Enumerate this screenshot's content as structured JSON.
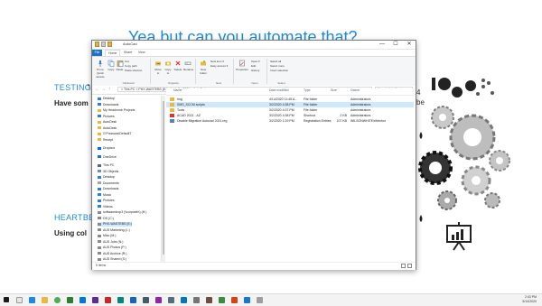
{
  "slide": {
    "title": "Yea but can you automate that?",
    "sec1_title": "TESTING",
    "sec1_body": "Have som",
    "sec2_title": "HEARTBE",
    "sec2_body": "Using col",
    "right_num1": "4",
    "right_text1": "be"
  },
  "window": {
    "title": "AutoCad",
    "controls": {
      "minimize": "—",
      "maximize": "☐",
      "close": "✕"
    },
    "tabs": [
      "File",
      "Home",
      "Share",
      "View"
    ],
    "ribbon": {
      "pin_label": "Pin to Quick access",
      "copy_label": "Copy",
      "paste_label": "Paste",
      "cut_label": "Cut",
      "copy_path_label": "Copy path",
      "paste_shortcut_label": "Paste shortcut",
      "clipboard_group": "Clipboard",
      "move_to_label": "Move to",
      "copy_to_label": "Copy to",
      "delete_label": "Delete",
      "rename_label": "Rename",
      "organize_group": "Organize",
      "new_folder_label": "New folder",
      "new_item_label": "New item ▾",
      "easy_access_label": "Easy access ▾",
      "new_group": "New",
      "properties_label": "Properties",
      "open_label": "Open ▾",
      "edit_label": "Edit",
      "history_label": "History",
      "open_group": "Open",
      "select_all_label": "Select all",
      "select_none_label": "Select none",
      "invert_label": "Invert selection",
      "select_group": "Select"
    },
    "address": "> This PC > PHX-WASTEBS (E:) > Install > 2021 > AutoCad",
    "search_placeholder": "Search AutoCad",
    "nav_items": [
      "Desktop",
      "Downloads",
      "My Headnone Projects",
      "Pictures",
      "AutoDesk",
      "AutoDesk",
      "GY*assocs\\DefaultT",
      "Recept",
      "Dropbox",
      "OneDrive",
      "This PC",
      "3D Objects",
      "Desktop",
      "Documents",
      "Downloads",
      "Music",
      "Pictures",
      "Videos",
      "softwaredrop3 (\\\\corpweb\\) (H:)",
      "OS (C:)",
      "PHX-WASTEBS (E:)",
      "AUS Marketing (L:)",
      "Misc (M:)",
      "AUS Jobs (N:)",
      "AUS Photos (P:)",
      "AUS Archive (R:)",
      "AUS Shared (S:)"
    ],
    "columns": {
      "name": "Name",
      "date": "Date modified",
      "type": "Type",
      "size": "Size",
      "owner": "Owner"
    },
    "files": [
      {
        "name": "Img",
        "date": "4/14/2020 11:45 A...",
        "type": "File folder",
        "size": "",
        "owner": "Administrators"
      },
      {
        "name": "SMS_SCCM scripts",
        "date": "3/2/2020 4:38 PM",
        "type": "File folder",
        "size": "",
        "owner": "Administrators"
      },
      {
        "name": "Tools",
        "date": "3/2/2020 4:37 PM",
        "type": "File folder",
        "size": "",
        "owner": "Administrators"
      },
      {
        "name": "ACAD 2021 - AZ",
        "date": "3/2/2020 4:38 PM",
        "type": "Shortcut",
        "size": "2 KB",
        "owner": "Administrators"
      },
      {
        "name": "Disable Migration Autocad 2021.reg",
        "date": "3/2/2020 1:29 PM",
        "type": "Registration Entries",
        "size": "107 KB",
        "owner": "WILSONWHITE\\rlfdmhor"
      }
    ],
    "status_count": "5 items"
  },
  "taskbar": {
    "time": "2:43 PM",
    "date": "5/14/2020"
  },
  "colors": {
    "accent_blue": "#1f8bd6",
    "file_tab": "#1a73c8",
    "selection": "#cde8ff",
    "folder": "#e8b93a"
  }
}
